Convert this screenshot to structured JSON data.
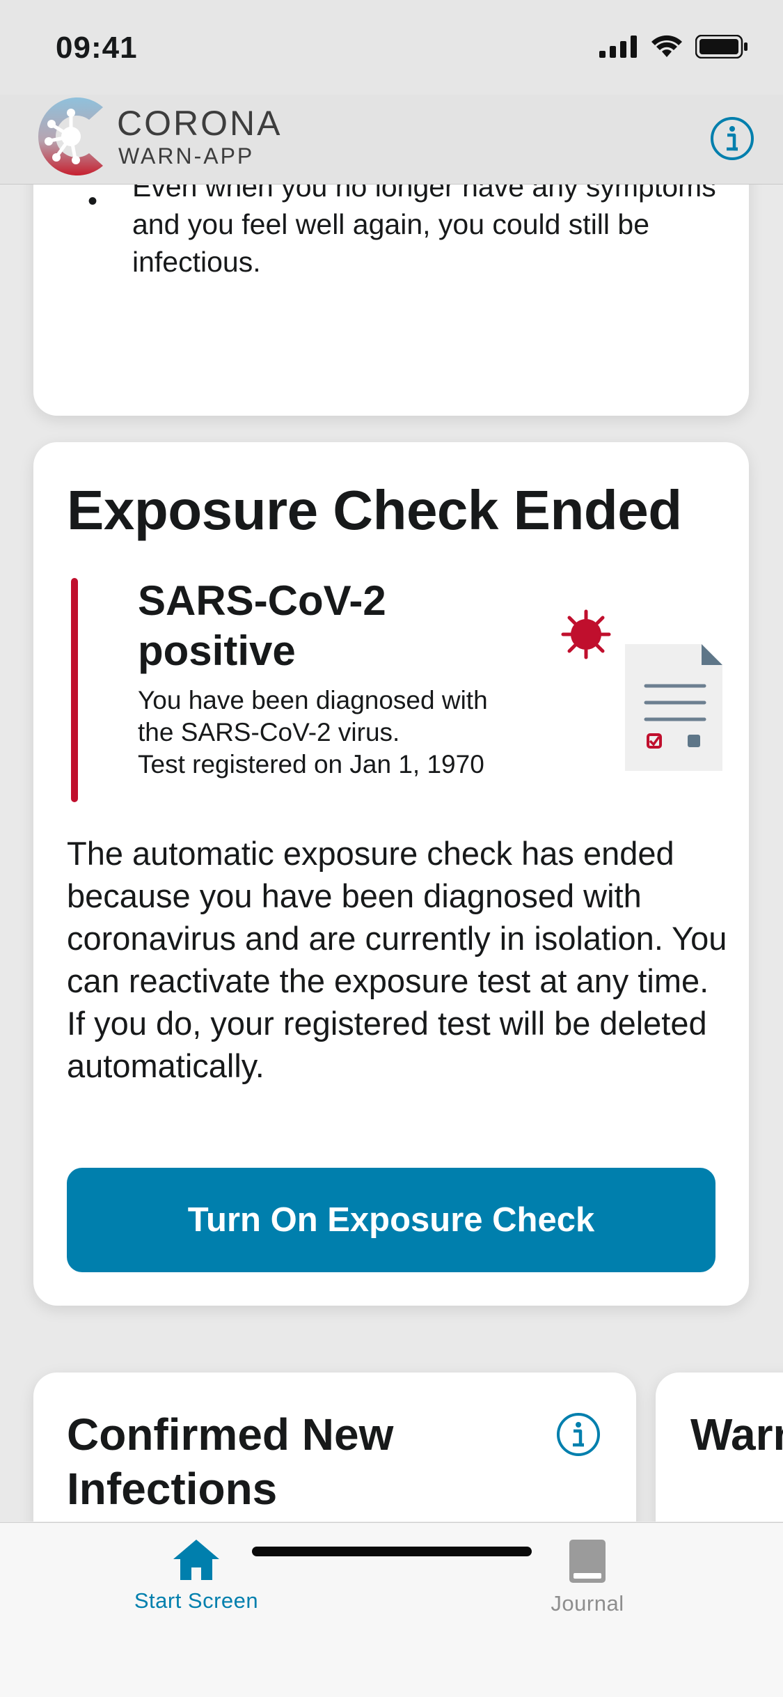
{
  "status_bar": {
    "time": "09:41"
  },
  "header": {
    "logo_line1": "CORONA",
    "logo_line2": "WARN-APP"
  },
  "top_card": {
    "bullet_text": "Even when you no longer have any symptoms and you feel well again, you could still be infectious."
  },
  "exposure_card": {
    "title": "Exposure Check Ended",
    "result_title": "SARS-CoV-2 positive",
    "result_line1": "You have been diagnosed with",
    "result_line2": "the SARS-CoV-2 virus.",
    "result_line3": "Test registered on Jan 1, 1970",
    "body": "The automatic exposure check has ended because you have been diagnosed with coronavirus and are currently in isolation. You can reactivate the exposure test at any time. If you do, your registered test will be deleted automatically.",
    "button_label": "Turn On Exposure Check"
  },
  "stats_cards": [
    {
      "title": "Confirmed New Infections"
    },
    {
      "title": "Warn App"
    }
  ],
  "tab_bar": {
    "items": [
      {
        "label": "Start Screen",
        "icon": "home-icon",
        "active": true
      },
      {
        "label": "Journal",
        "icon": "journal-icon",
        "active": false
      }
    ]
  },
  "colors": {
    "accent": "#007fad",
    "alert_red": "#c00f2d",
    "background": "#e9e9e9",
    "card": "#ffffff"
  }
}
